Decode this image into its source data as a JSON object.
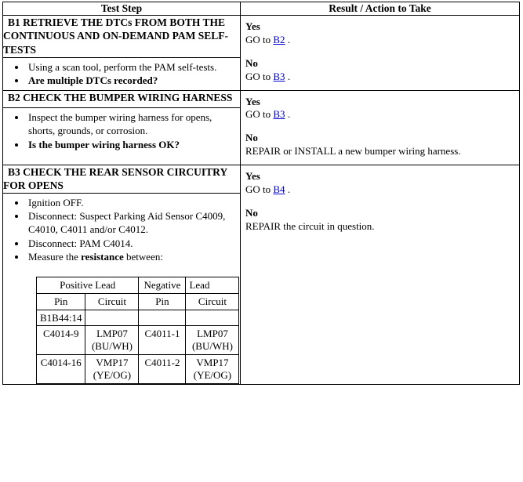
{
  "table": {
    "headers": {
      "test_step": "Test Step",
      "result": "Result / Action to Take"
    },
    "steps": [
      {
        "id": "B1",
        "title": "B1 RETRIEVE THE DTCs FROM BOTH THE CONTINUOUS AND ON-DEMAND PAM SELF-TESTS",
        "bullets": [
          {
            "text": "Using a scan tool, perform the PAM self-tests.",
            "bold": false
          },
          {
            "text": "Are multiple DTCs recorded?",
            "bold": true
          }
        ],
        "result": {
          "yes_label": "Yes",
          "yes_prefix": "GO to ",
          "yes_link": "B2",
          "yes_suffix": " .",
          "no_label": "No",
          "no_prefix": "GO to ",
          "no_link": "B3",
          "no_suffix": " ."
        }
      },
      {
        "id": "B2",
        "title": "B2 CHECK THE BUMPER WIRING HARNESS",
        "bullets": [
          {
            "text": "Inspect the bumper wiring harness for opens, shorts, grounds, or corrosion.",
            "bold": false
          },
          {
            "text": "Is the bumper wiring harness OK?",
            "bold": true
          }
        ],
        "result": {
          "yes_label": "Yes",
          "yes_prefix": "GO to ",
          "yes_link": "B3",
          "yes_suffix": " .",
          "no_label": "No",
          "no_prefix": "REPAIR or INSTALL a new bumper wiring harness.",
          "no_link": "",
          "no_suffix": ""
        }
      },
      {
        "id": "B3",
        "title": "B3 CHECK THE REAR SENSOR CIRCUITRY FOR OPENS",
        "bullets": [
          {
            "text": "Ignition OFF.",
            "bold": false
          },
          {
            "text": "Disconnect: Suspect Parking Aid Sensor C4009, C4010, C4011 and/or C4012.",
            "bold": false
          },
          {
            "text": "Disconnect: PAM C4014.",
            "bold": false
          },
          {
            "text": "Measure the resistance between:",
            "bold": false,
            "bold_word": "resistance"
          }
        ],
        "result": {
          "yes_label": "Yes",
          "yes_prefix": "GO to ",
          "yes_link": "B4",
          "yes_suffix": " .",
          "no_label": "No",
          "no_prefix": "REPAIR the circuit in question.",
          "no_link": "",
          "no_suffix": ""
        }
      }
    ],
    "lead_table": {
      "group_headers": [
        "Positive Lead",
        "Negative",
        "Lead"
      ],
      "column_headers": [
        "Pin",
        "Circuit",
        "Pin",
        "Circuit"
      ],
      "rows": [
        [
          "B1B44:14",
          "",
          "",
          ""
        ],
        [
          "C4014-9",
          "LMP07 (BU/WH)",
          "C4011-1",
          "LMP07 (BU/WH)"
        ],
        [
          "C4014-16",
          "VMP17 (YE/OG)",
          "C4011-2",
          "VMP17 (YE/OG)"
        ]
      ]
    }
  },
  "colors": {
    "link": "#0000cc",
    "border": "#000000",
    "text": "#000000",
    "background": "#ffffff"
  }
}
